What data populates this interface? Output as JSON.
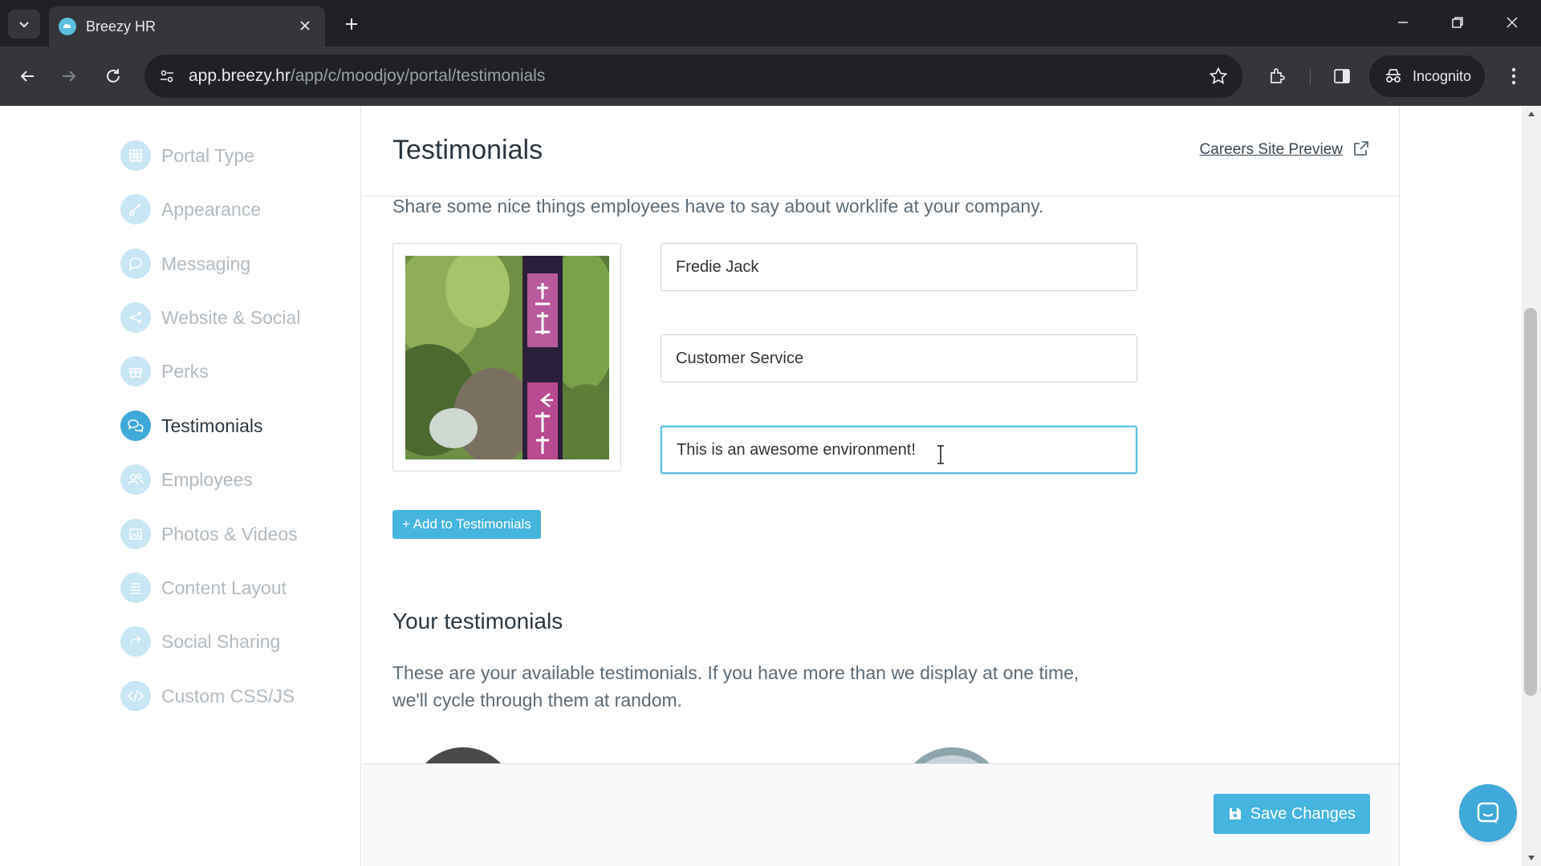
{
  "browser": {
    "tab_title": "Breezy HR",
    "url_domain": "app.breezy.hr",
    "url_path": "/app/c/moodjoy/portal/testimonials",
    "incognito_label": "Incognito"
  },
  "sidebar": {
    "items": [
      {
        "label": "Portal Type",
        "icon": "grid-icon",
        "active": false
      },
      {
        "label": "Appearance",
        "icon": "brush-icon",
        "active": false
      },
      {
        "label": "Messaging",
        "icon": "chat-icon",
        "active": false
      },
      {
        "label": "Website & Social",
        "icon": "share-icon",
        "active": false
      },
      {
        "label": "Perks",
        "icon": "gift-icon",
        "active": false
      },
      {
        "label": "Testimonials",
        "icon": "comments-icon",
        "active": true
      },
      {
        "label": "Employees",
        "icon": "users-icon",
        "active": false
      },
      {
        "label": "Photos & Videos",
        "icon": "image-icon",
        "active": false
      },
      {
        "label": "Content Layout",
        "icon": "list-icon",
        "active": false
      },
      {
        "label": "Social Sharing",
        "icon": "reshare-icon",
        "active": false
      },
      {
        "label": "Custom CSS/JS",
        "icon": "code-icon",
        "active": false
      }
    ]
  },
  "main": {
    "title": "Testimonials",
    "preview_link": "Careers Site Preview",
    "description": "Share some nice things employees have to say about worklife at your company.",
    "form": {
      "name_value": "Fredie Jack",
      "role_value": "Customer Service",
      "quote_value": "This is an awesome environment!"
    },
    "add_button": "+ Add to Testimonials",
    "section_title": "Your testimonials",
    "section_description": "These are your available testimonials. If you have more than we display at one time, we'll cycle through them at random.",
    "save_button": "Save Changes"
  },
  "colors": {
    "accent": "#45b4de",
    "active_nav": "#3fa9d9",
    "inactive_nav_text": "#b3bbc1"
  }
}
